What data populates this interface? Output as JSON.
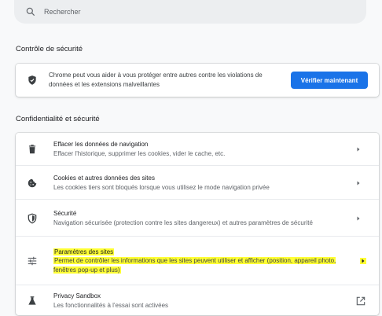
{
  "search": {
    "placeholder": "Rechercher"
  },
  "safety_check": {
    "heading": "Contrôle de sécurité",
    "description": "Chrome peut vous aider à vous protéger entre autres contre les violations de données et les extensions malveillantes",
    "button_label": "Vérifier maintenant",
    "accent_color": "#1a73e8"
  },
  "privacy": {
    "heading": "Confidentialité et sécurité",
    "items": [
      {
        "icon": "trash-icon",
        "title": "Effacer les données de navigation",
        "subtitle": "Effacer l'historique, supprimer les cookies, vider le cache, etc.",
        "trailing": "arrow-right-icon"
      },
      {
        "icon": "cookie-icon",
        "title": "Cookies et autres données des sites",
        "subtitle": "Les cookies tiers sont bloqués lorsque vous utilisez le mode navigation privée",
        "trailing": "arrow-right-icon"
      },
      {
        "icon": "shield-icon",
        "title": "Sécurité",
        "subtitle": "Navigation sécurisée (protection contre les sites dangereux) et autres paramètres de sécurité",
        "trailing": "arrow-right-icon"
      },
      {
        "icon": "tune-icon",
        "title": "Paramètres des sites",
        "subtitle": "Permet de contrôler les informations que les sites peuvent utiliser et afficher (position, appareil photo, fenêtres pop-up et plus)",
        "trailing": "arrow-right-icon",
        "highlighted": true,
        "highlight_color": "#ffff33"
      },
      {
        "icon": "flask-icon",
        "title": "Privacy Sandbox",
        "subtitle": "Les fonctionnalités à l'essai sont activées",
        "trailing": "open-in-new-icon"
      }
    ]
  }
}
